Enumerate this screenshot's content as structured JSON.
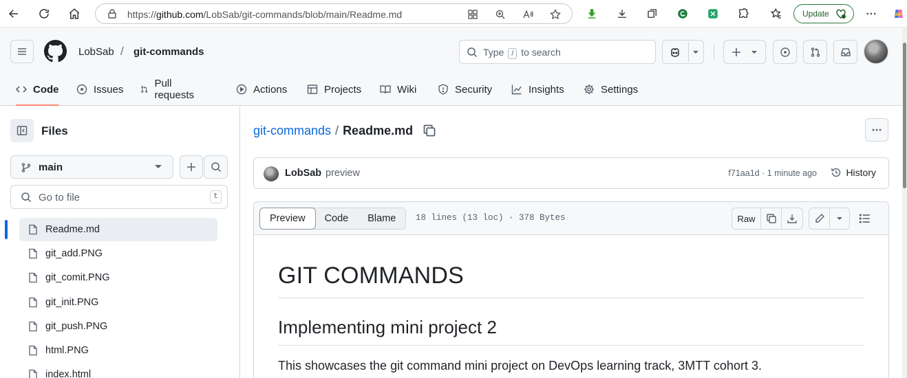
{
  "browser": {
    "url_prefix": "https://",
    "url_host": "github.com",
    "url_path": "/LobSab/git-commands/blob/main/Readme.md",
    "update_label": "Update"
  },
  "header": {
    "owner": "LobSab",
    "separator": "/",
    "repo": "git-commands",
    "search_prefix": "Type",
    "search_key": "/",
    "search_suffix": "to search"
  },
  "tabs": [
    {
      "label": "Code",
      "icon": "code-icon",
      "active": true
    },
    {
      "label": "Issues",
      "icon": "issue-icon"
    },
    {
      "label": "Pull requests",
      "icon": "pull-request-icon"
    },
    {
      "label": "Actions",
      "icon": "play-icon"
    },
    {
      "label": "Projects",
      "icon": "table-icon"
    },
    {
      "label": "Wiki",
      "icon": "book-icon"
    },
    {
      "label": "Security",
      "icon": "shield-icon"
    },
    {
      "label": "Insights",
      "icon": "graph-icon"
    },
    {
      "label": "Settings",
      "icon": "gear-icon"
    }
  ],
  "sidebar": {
    "title": "Files",
    "branch": "main",
    "goto_placeholder": "Go to file",
    "goto_key": "t",
    "files": [
      "Readme.md",
      "git_add.PNG",
      "git_comit.PNG",
      "git_init.PNG",
      "git_push.PNG",
      "html.PNG",
      "index.html"
    ],
    "selected_index": 0
  },
  "main": {
    "path_repo": "git-commands",
    "path_sep": "/",
    "path_file": "Readme.md",
    "commit": {
      "author": "LobSab",
      "message": "preview",
      "hash_time": "f71aa1d · 1 minute ago",
      "history_label": "History"
    },
    "toolbar": {
      "views": [
        "Preview",
        "Code",
        "Blame"
      ],
      "active_view": "Preview",
      "file_info": "18 lines (13 loc) · 378 Bytes",
      "raw_label": "Raw"
    },
    "markdown": {
      "h1": "GIT COMMANDS",
      "h2": "Implementing mini project 2",
      "p": "This showcases the git command mini project on DevOps learning track, 3MTT cohort 3."
    }
  },
  "colors": {
    "accent": "#0969da",
    "active_tab_underline": "#fd8c73",
    "update_green": "#2c7a37"
  }
}
